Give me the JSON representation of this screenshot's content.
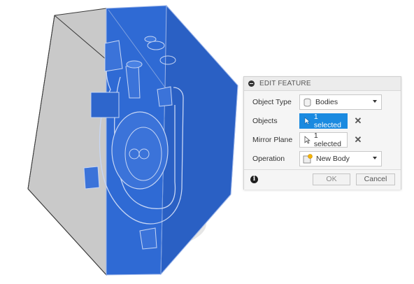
{
  "dialog": {
    "title": "EDIT FEATURE",
    "rows": {
      "object_type": {
        "label": "Object Type",
        "value": "Bodies"
      },
      "objects": {
        "label": "Objects",
        "value": "1 selected"
      },
      "mirror_plane": {
        "label": "Mirror Plane",
        "value": "1 selected"
      },
      "operation": {
        "label": "Operation",
        "value": "New Body"
      }
    },
    "ok_label": "OK",
    "cancel_label": "Cancel",
    "info_glyph": "i",
    "clear_glyph": "✕"
  },
  "colors": {
    "body_blue": "#2f6ad4",
    "selection_blue": "#1a8ae0",
    "box_gray": "#c8c8c8"
  },
  "icons": [
    "collapse-icon",
    "cylinder-body-icon",
    "cursor-select-icon",
    "clear-icon",
    "new-body-icon",
    "info-icon"
  ]
}
